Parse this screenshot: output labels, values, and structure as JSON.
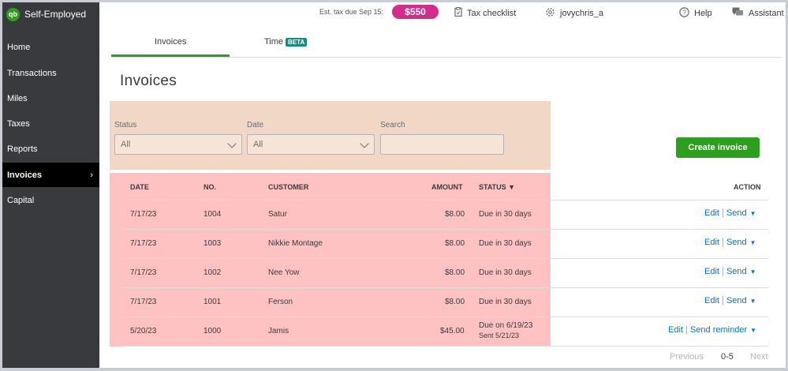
{
  "app": {
    "brand": "Self-Employed",
    "logo_text": "qb"
  },
  "sidebar": {
    "items": [
      {
        "label": "Home"
      },
      {
        "label": "Transactions"
      },
      {
        "label": "Miles"
      },
      {
        "label": "Taxes"
      },
      {
        "label": "Reports"
      },
      {
        "label": "Invoices",
        "active": true
      },
      {
        "label": "Capital"
      }
    ],
    "active_chevron": "›"
  },
  "topbar": {
    "tax_label": "Est. tax due Sep 15:",
    "tax_amount": "$550",
    "tax_checklist": "Tax checklist",
    "user": "jovychris_a",
    "help": "Help",
    "assistant": "Assistant"
  },
  "tabs": {
    "invoices": "Invoices",
    "time": "Time",
    "beta": "BETA"
  },
  "page_title": "Invoices",
  "filters": {
    "status_label": "Status",
    "status_value": "All",
    "date_label": "Date",
    "date_value": "All",
    "search_label": "Search",
    "search_value": ""
  },
  "create_button": "Create invoice",
  "table": {
    "headers": {
      "date": "DATE",
      "no": "NO.",
      "customer": "CUSTOMER",
      "amount": "AMOUNT",
      "status": "STATUS ▼",
      "action": "ACTION"
    },
    "rows": [
      {
        "date": "7/17/23",
        "no": "1004",
        "customer": "Satur",
        "amount": "$8.00",
        "status": "Due in 30 days",
        "status2": "",
        "edit": "Edit",
        "send": "Send"
      },
      {
        "date": "7/17/23",
        "no": "1003",
        "customer": "Nikkie Montage",
        "amount": "$8.00",
        "status": "Due in 30 days",
        "status2": "",
        "edit": "Edit",
        "send": "Send"
      },
      {
        "date": "7/17/23",
        "no": "1002",
        "customer": "Nee Yow",
        "amount": "$8.00",
        "status": "Due in 30 days",
        "status2": "",
        "edit": "Edit",
        "send": "Send"
      },
      {
        "date": "7/17/23",
        "no": "1001",
        "customer": "Ferson",
        "amount": "$8.00",
        "status": "Due in 30 days",
        "status2": "",
        "edit": "Edit",
        "send": "Send"
      },
      {
        "date": "5/20/23",
        "no": "1000",
        "customer": "Jamis",
        "amount": "$45.00",
        "status": "Due on 6/19/23",
        "status2": "Sent 5/21/23",
        "edit": "Edit",
        "send": "Send reminder"
      }
    ]
  },
  "pagination": {
    "previous": "Previous",
    "range": "0-5",
    "next": "Next"
  },
  "colors": {
    "brand_green": "#2ca01c",
    "tax_pink": "#d52b8b",
    "link_blue": "#0077c5",
    "sidebar": "#393a3d",
    "filter_highlight": "#f1d8c6",
    "table_highlight": "#fec2c2"
  }
}
